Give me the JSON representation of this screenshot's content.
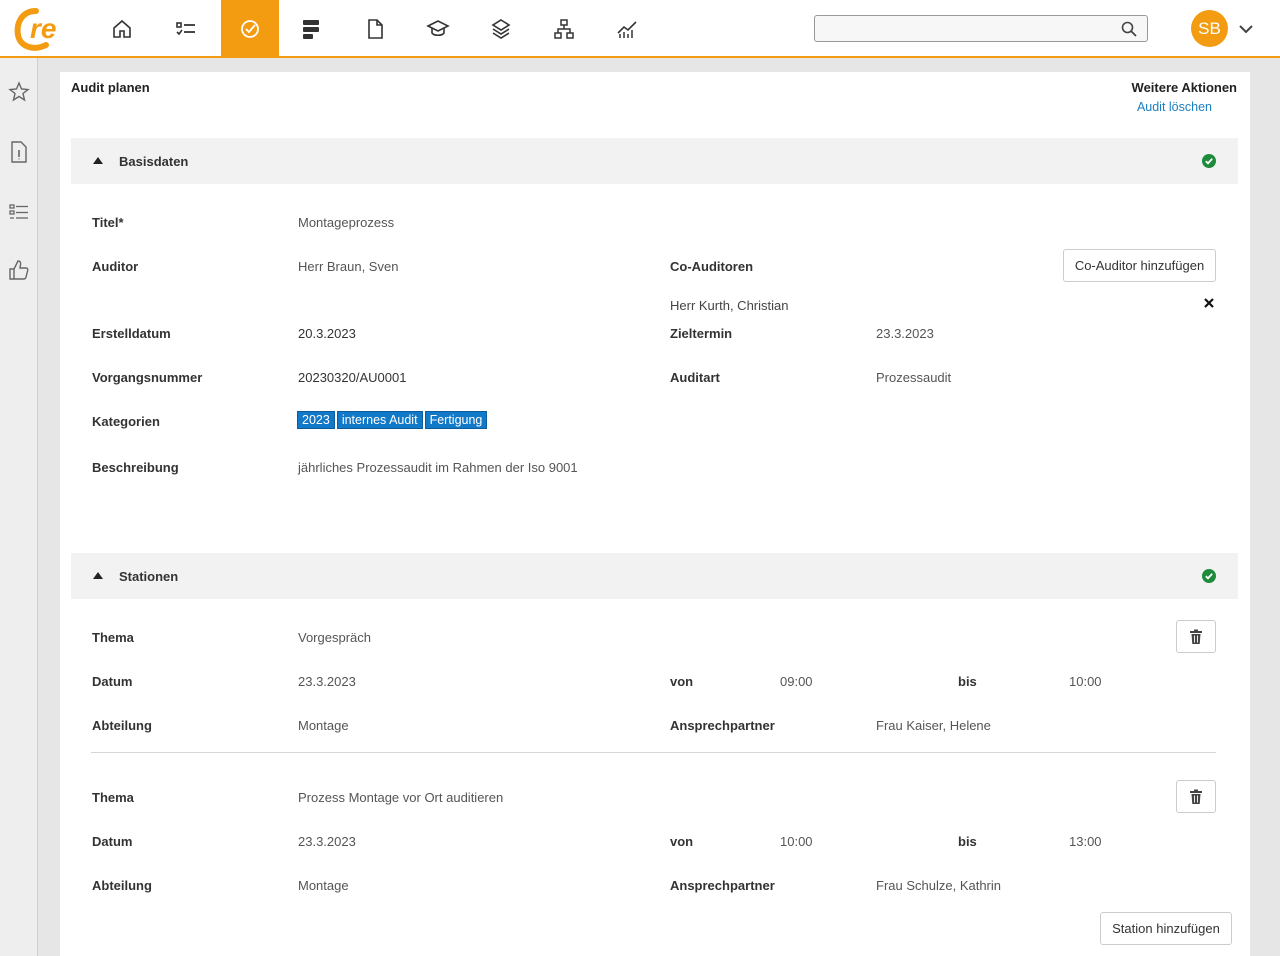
{
  "nav": {
    "items": [
      {
        "icon": "home-icon"
      },
      {
        "icon": "tasks-icon"
      },
      {
        "icon": "audit-check-icon",
        "active": true
      },
      {
        "icon": "stack-icon"
      },
      {
        "icon": "document-icon"
      },
      {
        "icon": "graduation-cap-icon"
      },
      {
        "icon": "layers-icon"
      },
      {
        "icon": "org-chart-icon"
      },
      {
        "icon": "analytics-icon"
      }
    ],
    "user_initials": "SB",
    "accent_color": "#f39c12"
  },
  "rail": {
    "icons": [
      "star-icon",
      "info-document-icon",
      "list-icon",
      "thumbs-up-icon"
    ]
  },
  "page": {
    "title": "Audit planen",
    "more_actions_label": "Weitere Aktionen",
    "delete_link": "Audit löschen"
  },
  "basisdaten": {
    "section_title": "Basisdaten",
    "titel_label": "Titel*",
    "titel_value": "Montageprozess",
    "auditor_label": "Auditor",
    "auditor_value": "Herr Braun, Sven",
    "co_auditors_label": "Co-Auditoren",
    "add_co_auditor_button": "Co-Auditor hinzufügen",
    "co_auditor_entry": "Herr Kurth, Christian",
    "erstelldatum_label": "Erstelldatum",
    "erstelldatum_value": "20.3.2023",
    "zieltermin_label": "Zieltermin",
    "zieltermin_value": "23.3.2023",
    "vorgangsnummer_label": "Vorgangsnummer",
    "vorgangsnummer_value": "20230320/AU0001",
    "auditart_label": "Auditart",
    "auditart_value": "Prozessaudit",
    "kategorien_label": "Kategorien",
    "kategorien": [
      "2023",
      "internes Audit",
      "Fertigung"
    ],
    "beschreibung_label": "Beschreibung",
    "beschreibung_value": "jährliches Prozessaudit im Rahmen der Iso 9001"
  },
  "stationen": {
    "section_title": "Stationen",
    "thema_label": "Thema",
    "datum_label": "Datum",
    "von_label": "von",
    "bis_label": "bis",
    "abteilung_label": "Abteilung",
    "ansprechpartner_label": "Ansprechpartner",
    "items": [
      {
        "thema": "Vorgespräch",
        "datum": "23.3.2023",
        "von": "09:00",
        "bis": "10:00",
        "abteilung": "Montage",
        "ansprechpartner": "Frau Kaiser, Helene"
      },
      {
        "thema": "Prozess Montage vor Ort auditieren",
        "datum": "23.3.2023",
        "von": "10:00",
        "bis": "13:00",
        "abteilung": "Montage",
        "ansprechpartner": "Frau Schulze, Kathrin"
      }
    ],
    "add_station_button": "Station hinzufügen"
  }
}
